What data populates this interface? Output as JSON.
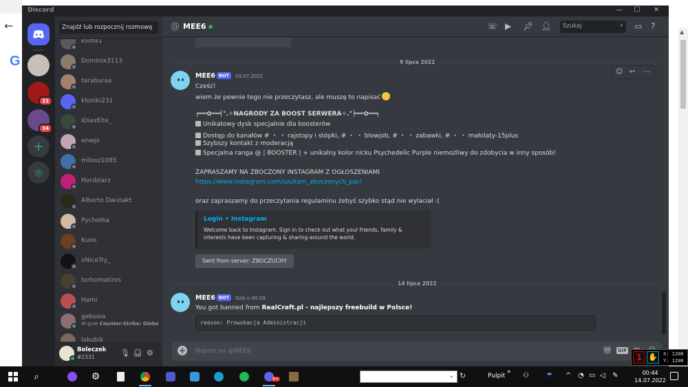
{
  "app": {
    "title": "Discord"
  },
  "window_controls": {
    "minimize": "—",
    "maximize": "☐",
    "close": "✕"
  },
  "guilds": [
    {
      "name": "home",
      "badge": ""
    },
    {
      "name": "server-1",
      "badge": ""
    },
    {
      "name": "server-2",
      "badge": "21"
    },
    {
      "name": "server-3",
      "badge": "34"
    }
  ],
  "sidebar": {
    "search_placeholder": "Znajdź lub rozpocznij rozmowę",
    "dms": [
      {
        "name": "kilot41",
        "status": "offline",
        "color": "#5a5a5a"
      },
      {
        "name": "Dominix3113",
        "status": "offline",
        "color": "#8b7b6b"
      },
      {
        "name": "taraburaa",
        "status": "offline",
        "color": "#a47f6e"
      },
      {
        "name": "kloniki231",
        "status": "offline",
        "color": "#5865f2"
      },
      {
        "name": "iDiaxElte_",
        "status": "offline",
        "color": "#3a4a3a"
      },
      {
        "name": "enwpi",
        "status": "offline",
        "color": "#c6a3b4"
      },
      {
        "name": "milosz1085",
        "status": "offline",
        "color": "#3f6fa8"
      },
      {
        "name": "Hordziarz",
        "status": "offline",
        "color": "#c21f7a"
      },
      {
        "name": "Alberto Dwutakt",
        "status": "offline",
        "color": "#2a2a1a"
      },
      {
        "name": "Pychotka",
        "status": "offline",
        "color": "#d3b8a8"
      },
      {
        "name": "Kuno",
        "status": "offline",
        "color": "#6b3f1f"
      },
      {
        "name": "xNiceTry_",
        "status": "offline",
        "color": "#111111"
      },
      {
        "name": "torbomatiros",
        "status": "offline",
        "color": "#4a4030"
      },
      {
        "name": "Hami",
        "status": "offline",
        "color": "#b85050"
      },
      {
        "name": "gabusia",
        "status": "online",
        "color": "#8a7070",
        "activity_prefix": "W grze ",
        "activity": "Counter-Strike: Global ..."
      },
      {
        "name": "Jakubik",
        "status": "offline",
        "color": "#7a6a5a"
      }
    ],
    "user": {
      "name": "Boleczek",
      "tag": "#2331"
    }
  },
  "header": {
    "channel_name": "MEE6",
    "search_placeholder": "Szukaj"
  },
  "chat": {
    "divider_1": "9 lipca 2022",
    "msg1": {
      "author": "MEE6",
      "bot_tag": "BOT",
      "time": "09.07.2022",
      "lines": [
        "Cześć!",
        "wiem że pewnie tego nie przeczytasz, ale muszę to napisać",
        "╒══✿══╡°.✧NAGRODY ZA BOOST SERWERA✧.°╞══✿══╕",
        "Unikatowy dysk specjalnie dla boosterów",
        "Dostęp do kanałów # ・ ・ rajstopy  i  stópki, # ・ ・ blowjob, # ・ ・ zabawki, # ・ ・ małolaty-15plus",
        "Szybszy kontakt z moderacją",
        "Specjalna ranga @ | BOOSTER |  + unikalny kolor nicku  Psychedelic Purple  niemożliwy do zdobycia w inny sposób!",
        "ZAPRASZAMY NA ZBOCZONY INSTAGRAM Z OGŁOSZENIAMI",
        "https://www.instagram.com/szukam_zboczonych_par/",
        "oraz zapraszamy do przeczytania regulaminu żebyś szybko stąd nie wylaciał :("
      ],
      "embed_title": "Login • Instagram",
      "embed_desc": "Welcome back to Instagram. Sign in to check out what your friends, family & interests have been capturing & sharing around the world.",
      "sent_from": "Sent from server: ZBOCZUCHY"
    },
    "divider_2": "14 lipca 2022",
    "msg2": {
      "author": "MEE6",
      "bot_tag": "BOT",
      "time": "Dziś o 00:29",
      "text_prefix": "You got banned from ",
      "text_bold": "RealCraft.pl - najlepszy freebuild w Polsce!",
      "code": "reason: Prowokacja Administracji"
    },
    "composer_placeholder": "Napisz na @MEE6",
    "gif_label": "GIF"
  },
  "overlay": {
    "icon1": "1",
    "x": "X: 1200",
    "y": "Y: 1200"
  },
  "taskbar": {
    "pulpit": "Pulpit",
    "chevron": "»",
    "time": "00:44",
    "date": "14.07.2022",
    "discord_badge": "9+"
  }
}
